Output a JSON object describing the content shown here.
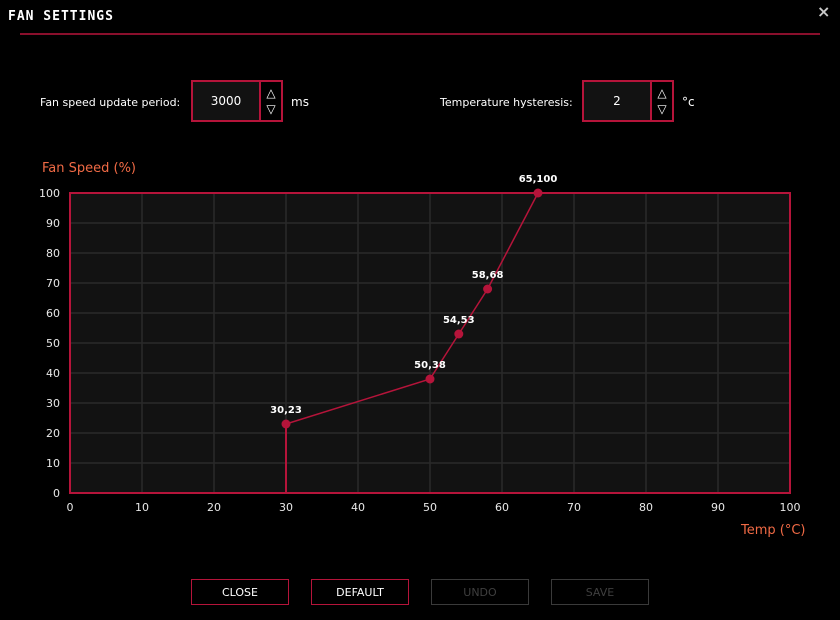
{
  "window": {
    "title": "FAN SETTINGS",
    "close_icon": "×"
  },
  "settings": {
    "update_period": {
      "label": "Fan speed update period:",
      "value": "3000",
      "unit": "ms"
    },
    "hysteresis": {
      "label": "Temperature hysteresis:",
      "value": "2",
      "unit": "°c"
    },
    "spin_up": "△",
    "spin_down": "▽"
  },
  "chart_data": {
    "type": "line",
    "ylabel": "Fan Speed (%)",
    "xlabel": "Temp (°C)",
    "xlim": [
      0,
      100
    ],
    "ylim": [
      0,
      100
    ],
    "x_ticks": [
      0,
      10,
      20,
      30,
      40,
      50,
      60,
      70,
      80,
      90,
      100
    ],
    "y_ticks": [
      0,
      10,
      20,
      30,
      40,
      50,
      60,
      70,
      80,
      90,
      100
    ],
    "grid": true,
    "series": [
      {
        "name": "fan-curve",
        "points": [
          {
            "x": 30,
            "y": 23,
            "label": "30,23"
          },
          {
            "x": 50,
            "y": 38,
            "label": "50,38"
          },
          {
            "x": 54,
            "y": 53,
            "label": "54,53"
          },
          {
            "x": 58,
            "y": 68,
            "label": "58,68"
          },
          {
            "x": 65,
            "y": 100,
            "label": "65,100"
          }
        ],
        "drop_line_to_zero_at_x": 30
      }
    ],
    "colors": {
      "line": "#b5143a",
      "plot_bg": "#121212",
      "grid": "#2a2a2a",
      "axis_title": "#f06a45"
    }
  },
  "buttons": {
    "close": "CLOSE",
    "default": "DEFAULT",
    "undo": "UNDO",
    "save": "SAVE"
  }
}
